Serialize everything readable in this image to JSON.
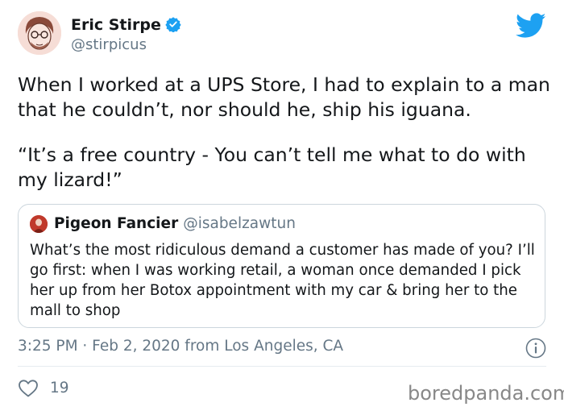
{
  "author": {
    "name": "Eric Stirpe",
    "handle": "@stirpicus",
    "verified": true
  },
  "tweet": {
    "paragraphs": [
      "When I worked at a UPS Store, I had to explain to a man that he couldn’t, nor should he, ship his iguana.",
      "“It’s a free country - You can’t tell me what to do with my lizard!”"
    ]
  },
  "quoted_tweet": {
    "name": "Pigeon Fancier",
    "handle": "@isabelzawtun",
    "text": "What’s the most ridiculous demand a customer has made of you? I’ll go first: when I was working retail, a woman once demanded I pick her up from her Botox appointment with my car & bring her to the mall to shop"
  },
  "meta": {
    "timestamp": "3:25 PM · Feb 2, 2020 from Los Angeles, CA"
  },
  "actions": {
    "like_count": "19"
  },
  "watermark": "boredpanda.com",
  "icons": {
    "verified": "verified-badge-icon",
    "logo": "twitter-bird-icon",
    "info": "info-icon",
    "like": "heart-icon"
  },
  "colors": {
    "twitter_blue": "#1da1f2",
    "secondary_text": "#657786",
    "border": "#ccd6dd"
  }
}
